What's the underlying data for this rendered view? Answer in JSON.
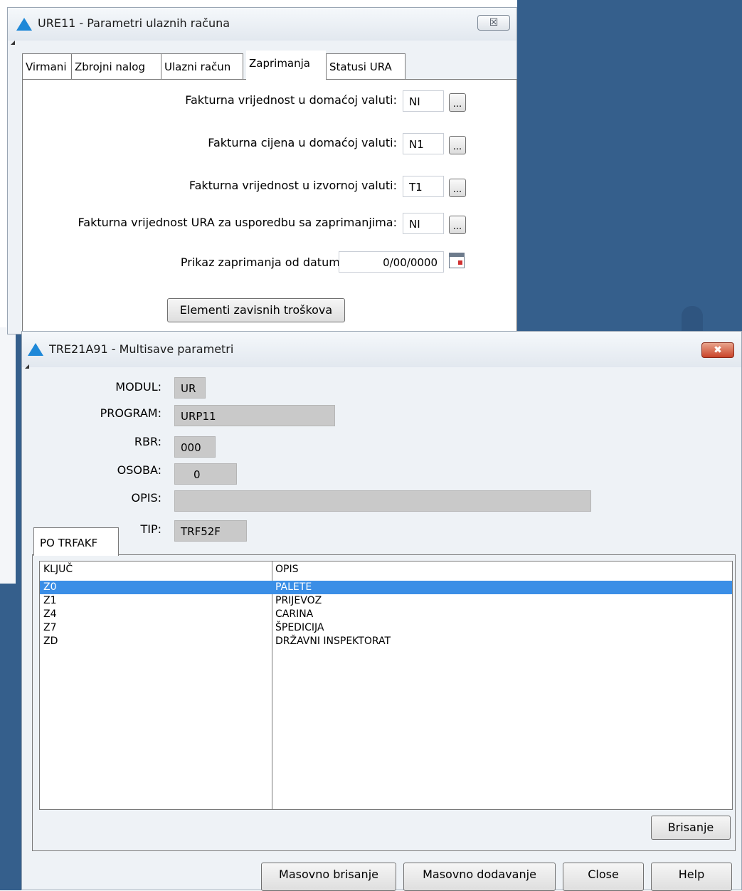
{
  "window1": {
    "title": "URE11 - Parametri ulaznih računa",
    "close_label": "☒",
    "tabs": [
      "Virmani",
      "Zbrojni nalog",
      "Ulazni račun",
      "Zaprimanja",
      "Statusi URA"
    ],
    "active_tab": "Zaprimanja",
    "fields": {
      "fakt_vrijednost_domaca": {
        "label": "Fakturna vrijednost u domaćoj valuti:",
        "value": "NI"
      },
      "fakt_cijena_domaca": {
        "label": "Fakturna cijena u domaćoj valuti:",
        "value": "N1"
      },
      "fakt_vrijednost_izvorna": {
        "label": "Fakturna vrijednost u izvornoj valuti:",
        "value": "T1"
      },
      "fakt_vrijednost_ura": {
        "label": "Fakturna vrijednost URA za usporedbu sa zaprimanjima:",
        "value": "NI"
      },
      "prikaz_od_datuma": {
        "label": "Prikaz zaprimanja od datuma:",
        "value": "0/00/0000"
      }
    },
    "dots_label": "...",
    "elementi_button": "Elementi zavisnih troškova"
  },
  "window2": {
    "title": "TRE21A91 - Multisave parametri",
    "close_label": "✖",
    "fields": {
      "modul": {
        "label": "MODUL:",
        "value": "UR"
      },
      "program": {
        "label": "PROGRAM:",
        "value": "URP11"
      },
      "rbr": {
        "label": "RBR:",
        "value": "000"
      },
      "osoba": {
        "label": "OSOBA:",
        "value": "0"
      },
      "opis": {
        "label": "OPIS:",
        "value": ""
      },
      "tip": {
        "label": "TIP:",
        "value": "TRF52F"
      }
    },
    "tab": "PO TRFAKF",
    "grid": {
      "columns": [
        "KLJUČ",
        "OPIS"
      ],
      "rows": [
        {
          "kljuc": "Z0",
          "opis": "PALETE",
          "selected": true
        },
        {
          "kljuc": "Z1",
          "opis": "PRIJEVOZ",
          "selected": false
        },
        {
          "kljuc": "Z4",
          "opis": "CARINA",
          "selected": false
        },
        {
          "kljuc": "Z7",
          "opis": "ŠPEDICIJA",
          "selected": false
        },
        {
          "kljuc": "ZD",
          "opis": "DRŽAVNI INSPEKTORAT",
          "selected": false
        }
      ]
    },
    "buttons": {
      "brisanje": "Brisanje",
      "masovno_brisanje": "Masovno brisanje",
      "masovno_dodavanje": "Masovno dodavanje",
      "close": "Close",
      "help": "Help"
    }
  }
}
